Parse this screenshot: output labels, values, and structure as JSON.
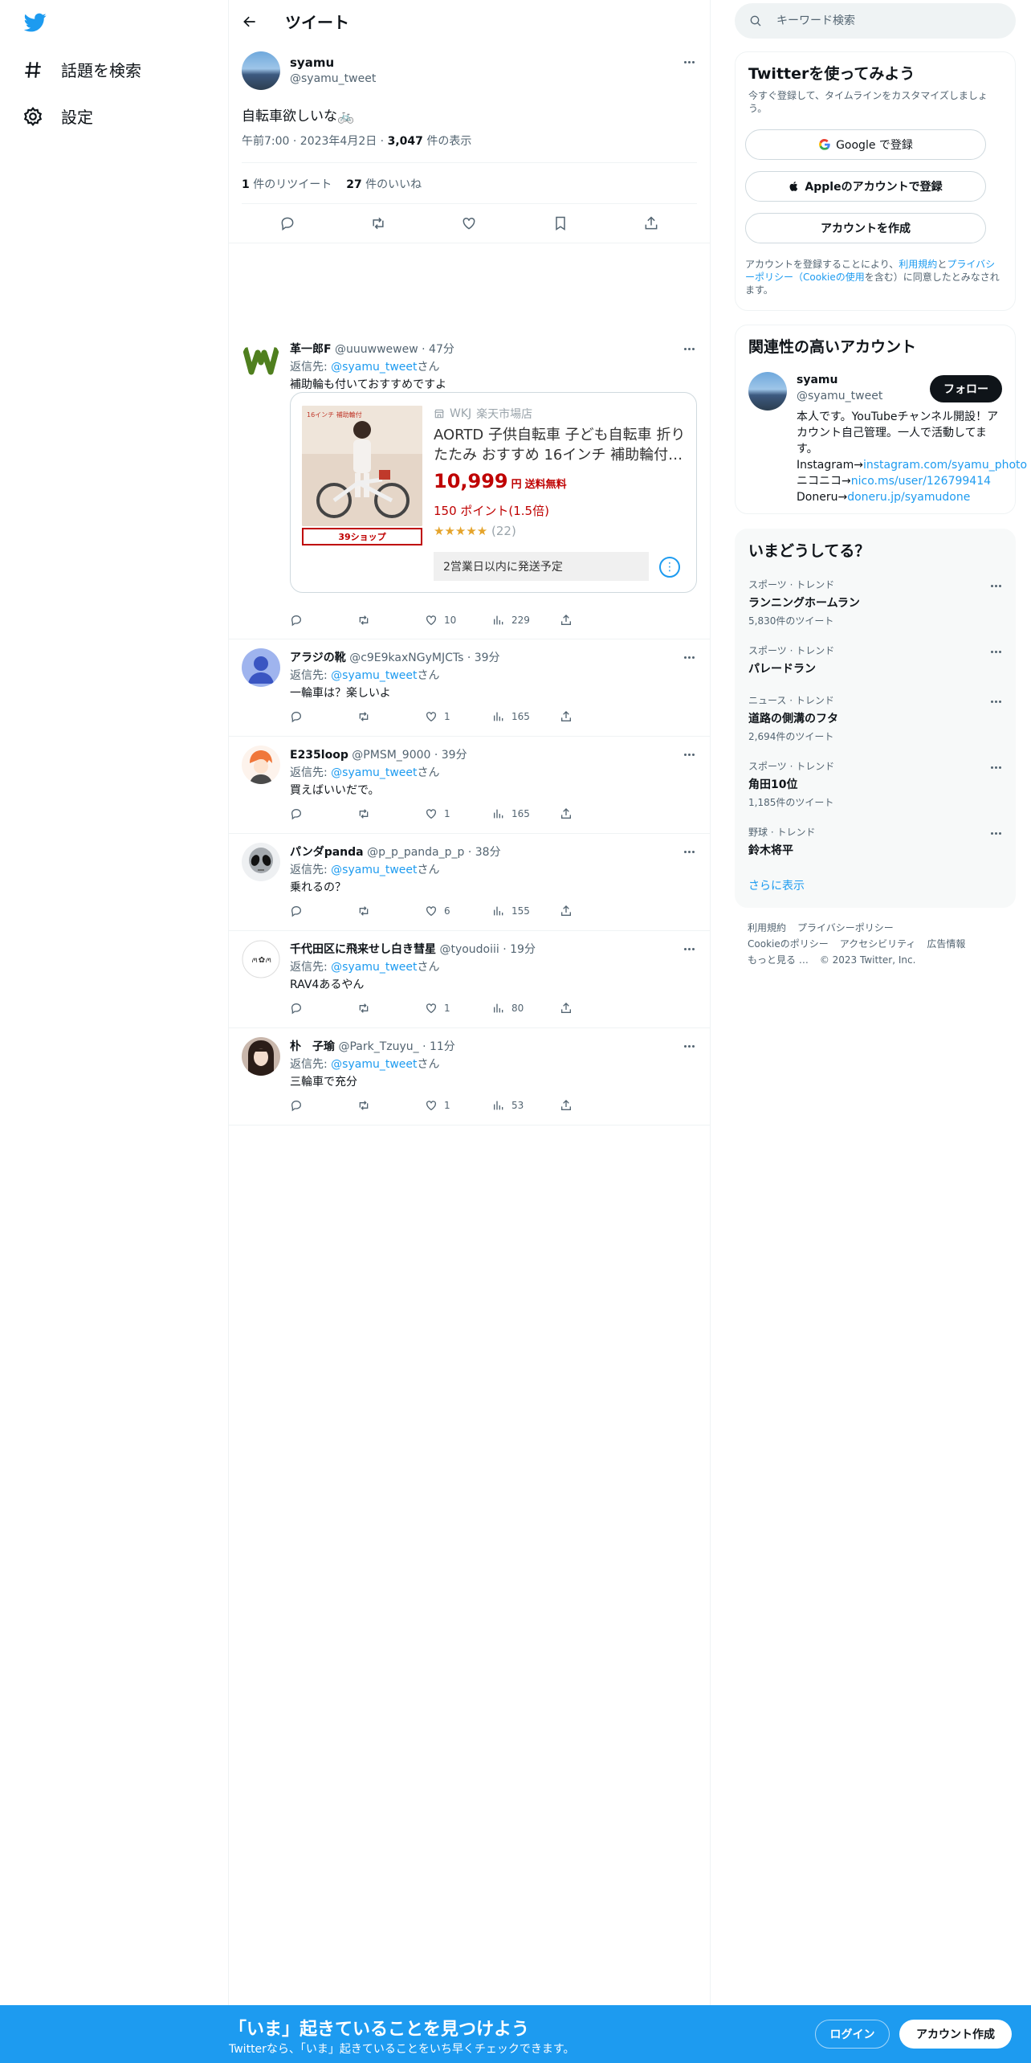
{
  "nav": {
    "explore_label": "話題を検索",
    "settings_label": "設定"
  },
  "header": {
    "title": "ツイート"
  },
  "tweet": {
    "name": "syamu",
    "handle": "@syamu_tweet",
    "text": "自転車欲しいな🚲",
    "time": "午前7:00 · 2023年4月2日 · ",
    "views_count": "3,047",
    "views_label": " 件の表示",
    "retweets_count": "1",
    "retweets_label": " 件のリツイート",
    "likes_count": "27",
    "likes_label": " 件のいいね"
  },
  "replies": [
    {
      "name": "革一郎F",
      "handle": "@uuuwwewew",
      "time": " · 47分",
      "to_prefix": "返信先: ",
      "to_handle": "@syamu_tweet",
      "to_suffix": "さん",
      "text": "補助輪も付いておすすめですよ",
      "likes": "10",
      "views": "229",
      "card": {
        "store_code": "WKJ",
        "store_name": "楽天市場店",
        "title": "AORTD 子供自転車 子ども自転車 折りたたみ おすすめ 16インチ 補助輪付…",
        "price": "10,999",
        "price_unit": "円",
        "shipping_free": "送料無料",
        "points": "150 ポイント(1.5倍)",
        "stars": "★★★★★",
        "review_count": "(22)",
        "ship_note": "2営業日以内に発送予定",
        "badge": "39ショップ",
        "image_caption": "16インチ 補助輪付"
      }
    },
    {
      "name": "アラジの靴",
      "handle": "@c9E9kaxNGyMJCTs",
      "time": " · 39分",
      "to_prefix": "返信先: ",
      "to_handle": "@syamu_tweet",
      "to_suffix": "さん",
      "text": "一輪車は？楽しいよ",
      "likes": "1",
      "views": "165"
    },
    {
      "name": "E235loop",
      "handle": "@PMSM_9000",
      "time": " · 39分",
      "to_prefix": "返信先: ",
      "to_handle": "@syamu_tweet",
      "to_suffix": "さん",
      "text": "買えばいいだで。",
      "likes": "1",
      "views": "165"
    },
    {
      "name": "パンダpanda",
      "handle": "@p_p_panda_p_p",
      "time": " · 38分",
      "to_prefix": "返信先: ",
      "to_handle": "@syamu_tweet",
      "to_suffix": "さん",
      "text": "乗れるの？",
      "likes": "6",
      "views": "155"
    },
    {
      "name": "千代田区に飛来せし白き彗星",
      "handle": "@tyoudoiii",
      "time": " · 19分",
      "to_prefix": "返信先: ",
      "to_handle": "@syamu_tweet",
      "to_suffix": "さん",
      "text": "RAV4あるやん",
      "likes": "1",
      "views": "80"
    },
    {
      "name": "朴　子瑜",
      "handle": "@Park_Tzuyu_",
      "time": " · 11分",
      "to_prefix": "返信先: ",
      "to_handle": "@syamu_tweet",
      "to_suffix": "さん",
      "text": "三輪車で充分",
      "likes": "1",
      "views": "53"
    }
  ],
  "search": {
    "placeholder": "キーワード検索"
  },
  "signup_panel": {
    "title": "Twitterを使ってみよう",
    "subtitle": "今すぐ登録して、タイムラインをカスタマイズしましょう。",
    "google": "Google で登録",
    "apple": "Appleのアカウントで登録",
    "create": "アカウントを作成",
    "legal_1": "アカウントを登録することにより、",
    "legal_terms": "利用規約",
    "legal_2": "と",
    "legal_privacy": "プライバシーポリシー（Cookieの使用",
    "legal_3": "を含む）に同意したとみなされます。"
  },
  "related": {
    "title": "関連性の高いアカウント",
    "name": "syamu",
    "handle": "@syamu_tweet",
    "follow": "フォロー",
    "bio_1": "本人です。YouTubeチャンネル開設！アカウント自己管理。一人で活動してます。 Instagram→",
    "bio_link1": "instagram.com/syamu_photo",
    "bio_2": " ニコニコ→",
    "bio_link2": "nico.ms/user/126799414",
    "bio_3": " Doneru→",
    "bio_link3": "doneru.jp/syamudone"
  },
  "trends": {
    "title": "いまどうしてる？",
    "items": [
      {
        "category": "スポーツ · トレンド",
        "name": "ランニングホームラン",
        "count": "5,830件のツイート"
      },
      {
        "category": "スポーツ · トレンド",
        "name": "パレードラン",
        "count": ""
      },
      {
        "category": "ニュース · トレンド",
        "name": "道路の側溝のフタ",
        "count": "2,694件のツイート"
      },
      {
        "category": "スポーツ · トレンド",
        "name": "角田10位",
        "count": "1,185件のツイート"
      },
      {
        "category": "野球 · トレンド",
        "name": "鈴木将平",
        "count": ""
      }
    ],
    "show_more": "さらに表示"
  },
  "footer": {
    "terms": "利用規約",
    "privacy": "プライバシーポリシー",
    "cookie": "Cookieのポリシー",
    "accessibility": "アクセシビリティ",
    "ads": "広告情報",
    "more": "もっと見る …",
    "copyright": "© 2023 Twitter, Inc."
  },
  "bottom_bar": {
    "headline": "「いま」起きていることを見つけよう",
    "sub": "Twitterなら、「いま」起きていることをいち早くチェックできます。",
    "login": "ログイン",
    "signup": "アカウント作成"
  },
  "colors": {
    "accent": "#1d9bf0",
    "text": "#0f1419",
    "muted": "#536471",
    "rakuten_red": "#bf0000"
  }
}
